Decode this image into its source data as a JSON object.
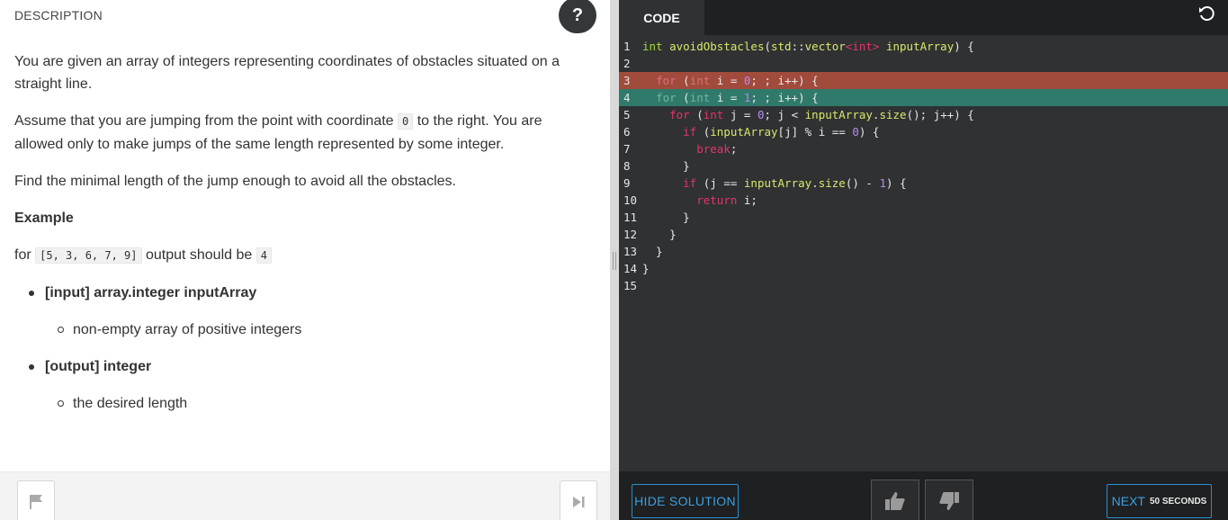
{
  "description": {
    "header": "DESCRIPTION",
    "help_label": "?",
    "para1": "You are given an array of integers representing coordinates of obstacles situated on a straight line.",
    "para2_before": "Assume that you are jumping from the point with coordinate",
    "para2_code": "0",
    "para2_after": "to the right. You are allowed only to make jumps of the same length represented by some integer.",
    "para3": "Find the minimal length of the jump enough to avoid all the obstacles.",
    "example_heading": "Example",
    "example_prefix": "for",
    "example_input": "[5, 3, 6, 7, 9]",
    "example_middle": "output should be",
    "example_output": "4",
    "input_label": "[input] array.integer inputArray",
    "input_desc": "non-empty array of positive integers",
    "output_label": "[output] integer",
    "output_desc": "the desired length"
  },
  "left_footer": {
    "flag_icon": "flag-icon",
    "skip_icon": "skip-forward-icon"
  },
  "code_panel": {
    "tab_label": "CODE",
    "reset_icon": "reset-icon",
    "line_numbers": [
      "1",
      "2",
      "3",
      "4",
      "5",
      "6",
      "7",
      "8",
      "9",
      "10",
      "11",
      "12",
      "13",
      "14",
      "15"
    ]
  },
  "diff_colors": {
    "removed": "#a14b3c",
    "added": "#2f7a6a"
  },
  "code_footer": {
    "hide_solution_label": "HIDE SOLUTION",
    "next_label": "NEXT",
    "next_timer": "50 SECONDS",
    "thumbs_up_icon": "thumbs-up-icon",
    "thumbs_down_icon": "thumbs-down-icon"
  }
}
